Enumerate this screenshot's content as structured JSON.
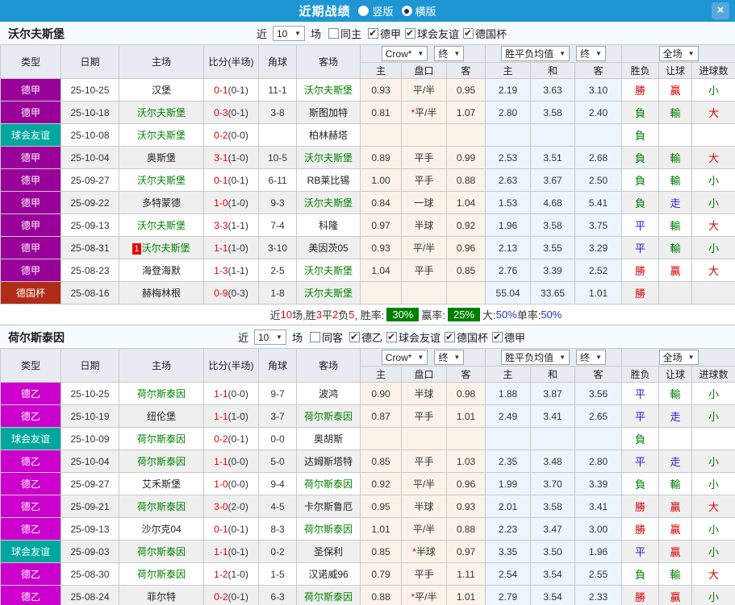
{
  "titlebar": {
    "title": "近期战绩",
    "vertical_label": "竖版",
    "horizontal_label": "横版",
    "close_glyph": "×"
  },
  "controls": {
    "near": "近",
    "count": "10",
    "games": "场",
    "crow": "Crow*",
    "final": "终",
    "avg": "胜平负均值",
    "fulltime": "全场"
  },
  "headers": {
    "type": "类型",
    "date": "日期",
    "home": "主场",
    "score": "比分(半场)",
    "corner": "角球",
    "away": "客场",
    "odds_home": "主",
    "handicap": "盘口",
    "odds_away": "客",
    "avg_home": "主",
    "avg_draw": "和",
    "avg_away": "客",
    "result": "胜负",
    "let_ball": "让球",
    "goals": "进球数"
  },
  "type_colors": {
    "德甲": "#990099",
    "德乙": "#CC00CC",
    "球会友谊": "#00A79E",
    "德国杯": "#B02C18"
  },
  "result_colors": {
    "勝": "#D50000",
    "贏": "#D50000",
    "大": "#D50000",
    "負": "#008000",
    "輸": "#008000",
    "小": "#008000",
    "平": "#2222D0",
    "走": "#2222D0"
  },
  "sections": [
    {
      "team": "沃尔夫斯堡",
      "same_label": "同主",
      "same_checked": false,
      "leagues": [
        {
          "label": "德甲",
          "checked": true
        },
        {
          "label": "球会友谊",
          "checked": true
        },
        {
          "label": "德国杯",
          "checked": true
        }
      ],
      "rows": [
        {
          "type": "德甲",
          "date": "25-10-25",
          "home": "汉堡",
          "home_focus": false,
          "rank": "",
          "score": "0-1",
          "half": "(0-1)",
          "corner": "11-1",
          "away": "沃尔夫斯堡",
          "away_focus": true,
          "odds": [
            "0.93",
            "平/半",
            "0.95"
          ],
          "avg": [
            "2.19",
            "3.63",
            "3.10"
          ],
          "outcome": [
            "勝",
            "贏",
            "小"
          ]
        },
        {
          "type": "德甲",
          "date": "25-10-18",
          "home": "沃尔夫斯堡",
          "home_focus": true,
          "rank": "",
          "score": "0-3",
          "half": "(0-1)",
          "corner": "3-8",
          "away": "斯图加特",
          "away_focus": false,
          "odds": [
            "0.81",
            "*平/半",
            "1.07"
          ],
          "avg": [
            "2.80",
            "3.58",
            "2.40"
          ],
          "outcome": [
            "負",
            "輸",
            "大"
          ]
        },
        {
          "type": "球会友谊",
          "date": "25-10-08",
          "home": "沃尔夫斯堡",
          "home_focus": true,
          "rank": "",
          "score": "0-2",
          "half": "(0-0)",
          "corner": "",
          "away": "柏林赫塔",
          "away_focus": false,
          "odds": [
            "",
            "",
            ""
          ],
          "avg": [
            "",
            "",
            ""
          ],
          "outcome": [
            "負",
            "",
            ""
          ]
        },
        {
          "type": "德甲",
          "date": "25-10-04",
          "home": "奥斯堡",
          "home_focus": false,
          "rank": "",
          "score": "3-1",
          "half": "(1-0)",
          "corner": "10-5",
          "away": "沃尔夫斯堡",
          "away_focus": true,
          "odds": [
            "0.89",
            "平手",
            "0.99"
          ],
          "avg": [
            "2.53",
            "3.51",
            "2.68"
          ],
          "outcome": [
            "負",
            "輸",
            "大"
          ]
        },
        {
          "type": "德甲",
          "date": "25-09-27",
          "home": "沃尔夫斯堡",
          "home_focus": true,
          "rank": "",
          "score": "0-1",
          "half": "(0-1)",
          "corner": "6-11",
          "away": "RB莱比锡",
          "away_focus": false,
          "odds": [
            "1.00",
            "平手",
            "0.88"
          ],
          "avg": [
            "2.63",
            "3.67",
            "2.50"
          ],
          "outcome": [
            "負",
            "輸",
            "小"
          ]
        },
        {
          "type": "德甲",
          "date": "25-09-22",
          "home": "多特蒙德",
          "home_focus": false,
          "rank": "",
          "score": "1-0",
          "half": "(1-0)",
          "corner": "9-3",
          "away": "沃尔夫斯堡",
          "away_focus": true,
          "odds": [
            "0.84",
            "一球",
            "1.04"
          ],
          "avg": [
            "1.53",
            "4.68",
            "5.41"
          ],
          "outcome": [
            "負",
            "走",
            "小"
          ]
        },
        {
          "type": "德甲",
          "date": "25-09-13",
          "home": "沃尔夫斯堡",
          "home_focus": true,
          "rank": "",
          "score": "3-3",
          "half": "(1-1)",
          "corner": "7-4",
          "away": "科隆",
          "away_focus": false,
          "odds": [
            "0.97",
            "半球",
            "0.92"
          ],
          "avg": [
            "1.96",
            "3.58",
            "3.75"
          ],
          "outcome": [
            "平",
            "輸",
            "大"
          ]
        },
        {
          "type": "德甲",
          "date": "25-08-31",
          "home": "沃尔夫斯堡",
          "home_focus": true,
          "rank": "1",
          "score": "1-1",
          "half": "(1-0)",
          "corner": "3-10",
          "away": "美因茨05",
          "away_focus": false,
          "odds": [
            "0.93",
            "平/半",
            "0.96"
          ],
          "avg": [
            "2.13",
            "3.55",
            "3.29"
          ],
          "outcome": [
            "平",
            "輸",
            "小"
          ]
        },
        {
          "type": "德甲",
          "date": "25-08-23",
          "home": "海登海默",
          "home_focus": false,
          "rank": "",
          "score": "1-3",
          "half": "(1-1)",
          "corner": "2-5",
          "away": "沃尔夫斯堡",
          "away_focus": true,
          "odds": [
            "1.04",
            "平手",
            "0.85"
          ],
          "avg": [
            "2.76",
            "3.39",
            "2.52"
          ],
          "outcome": [
            "勝",
            "贏",
            "大"
          ]
        },
        {
          "type": "德国杯",
          "date": "25-08-16",
          "home": "赫梅林根",
          "home_focus": false,
          "rank": "",
          "score": "0-9",
          "half": "(0-3)",
          "corner": "1-8",
          "away": "沃尔夫斯堡",
          "away_focus": true,
          "odds": [
            "",
            "",
            ""
          ],
          "avg": [
            "55.04",
            "33.65",
            "1.01"
          ],
          "outcome": [
            "勝",
            "",
            ""
          ]
        }
      ],
      "summary": [
        {
          "text": "近",
          "style": "plain"
        },
        {
          "text": "10",
          "style": "red"
        },
        {
          "text": "场,胜",
          "style": "plain"
        },
        {
          "text": "3",
          "style": "red"
        },
        {
          "text": "平",
          "style": "plain"
        },
        {
          "text": "2",
          "style": "red"
        },
        {
          "text": "负",
          "style": "plain"
        },
        {
          "text": "5",
          "style": "red"
        },
        {
          "text": ", 胜率: ",
          "style": "plain"
        },
        {
          "text": "30%",
          "style": "badge"
        },
        {
          "text": " 赢率: ",
          "style": "plain"
        },
        {
          "text": "25%",
          "style": "badge"
        },
        {
          "text": " 大:",
          "style": "plain"
        },
        {
          "text": "50%",
          "style": "blue"
        },
        {
          "text": " 单率:",
          "style": "plain"
        },
        {
          "text": "50%",
          "style": "blue"
        }
      ]
    },
    {
      "team": "荷尔斯泰因",
      "same_label": "同客",
      "same_checked": false,
      "leagues": [
        {
          "label": "德乙",
          "checked": true
        },
        {
          "label": "球会友谊",
          "checked": true
        },
        {
          "label": "德国杯",
          "checked": true
        },
        {
          "label": "德甲",
          "checked": true
        }
      ],
      "rows": [
        {
          "type": "德乙",
          "date": "25-10-25",
          "home": "荷尔斯泰因",
          "home_focus": true,
          "rank": "",
          "score": "1-1",
          "half": "(0-0)",
          "corner": "9-7",
          "away": "波鸿",
          "away_focus": false,
          "odds": [
            "0.90",
            "半球",
            "0.98"
          ],
          "avg": [
            "1.88",
            "3.87",
            "3.56"
          ],
          "outcome": [
            "平",
            "輸",
            "小"
          ]
        },
        {
          "type": "德乙",
          "date": "25-10-19",
          "home": "纽伦堡",
          "home_focus": false,
          "rank": "",
          "score": "1-1",
          "half": "(1-0)",
          "corner": "3-7",
          "away": "荷尔斯泰因",
          "away_focus": true,
          "odds": [
            "0.87",
            "平手",
            "1.01"
          ],
          "avg": [
            "2.49",
            "3.41",
            "2.65"
          ],
          "outcome": [
            "平",
            "走",
            "小"
          ]
        },
        {
          "type": "球会友谊",
          "date": "25-10-09",
          "home": "荷尔斯泰因",
          "home_focus": true,
          "rank": "",
          "score": "0-2",
          "half": "(0-1)",
          "corner": "0-0",
          "away": "奥胡斯",
          "away_focus": false,
          "odds": [
            "",
            "",
            ""
          ],
          "avg": [
            "",
            "",
            ""
          ],
          "outcome": [
            "負",
            "",
            ""
          ]
        },
        {
          "type": "德乙",
          "date": "25-10-04",
          "home": "荷尔斯泰因",
          "home_focus": true,
          "rank": "",
          "score": "1-1",
          "half": "(0-0)",
          "corner": "5-0",
          "away": "达姆斯塔特",
          "away_focus": false,
          "odds": [
            "0.85",
            "平手",
            "1.03"
          ],
          "avg": [
            "2.35",
            "3.48",
            "2.80"
          ],
          "outcome": [
            "平",
            "走",
            "小"
          ]
        },
        {
          "type": "德乙",
          "date": "25-09-27",
          "home": "艾禾斯堡",
          "home_focus": false,
          "rank": "",
          "score": "1-0",
          "half": "(0-0)",
          "corner": "9-4",
          "away": "荷尔斯泰因",
          "away_focus": true,
          "odds": [
            "0.92",
            "平/半",
            "0.96"
          ],
          "avg": [
            "1.99",
            "3.70",
            "3.39"
          ],
          "outcome": [
            "負",
            "輸",
            "小"
          ]
        },
        {
          "type": "德乙",
          "date": "25-09-21",
          "home": "荷尔斯泰因",
          "home_focus": true,
          "rank": "",
          "score": "3-0",
          "half": "(2-0)",
          "corner": "4-5",
          "away": "卡尔斯鲁厄",
          "away_focus": false,
          "odds": [
            "0.95",
            "半球",
            "0.93"
          ],
          "avg": [
            "2.01",
            "3.58",
            "3.41"
          ],
          "outcome": [
            "勝",
            "贏",
            "大"
          ]
        },
        {
          "type": "德乙",
          "date": "25-09-13",
          "home": "沙尔克04",
          "home_focus": false,
          "rank": "",
          "score": "0-1",
          "half": "(0-1)",
          "corner": "8-3",
          "away": "荷尔斯泰因",
          "away_focus": true,
          "odds": [
            "1.01",
            "平/半",
            "0.88"
          ],
          "avg": [
            "2.23",
            "3.47",
            "3.00"
          ],
          "outcome": [
            "勝",
            "贏",
            "小"
          ]
        },
        {
          "type": "球会友谊",
          "date": "25-09-03",
          "home": "荷尔斯泰因",
          "home_focus": true,
          "rank": "",
          "score": "1-1",
          "half": "(0-1)",
          "corner": "0-2",
          "away": "圣保利",
          "away_focus": false,
          "odds": [
            "0.85",
            "*半球",
            "0.97"
          ],
          "avg": [
            "3.35",
            "3.50",
            "1.96"
          ],
          "outcome": [
            "平",
            "贏",
            "小"
          ]
        },
        {
          "type": "德乙",
          "date": "25-08-30",
          "home": "荷尔斯泰因",
          "home_focus": true,
          "rank": "",
          "score": "1-2",
          "half": "(1-0)",
          "corner": "1-5",
          "away": "汉诺威96",
          "away_focus": false,
          "odds": [
            "0.79",
            "平手",
            "1.11"
          ],
          "avg": [
            "2.54",
            "3.54",
            "2.55"
          ],
          "outcome": [
            "負",
            "輸",
            "大"
          ]
        },
        {
          "type": "德乙",
          "date": "25-08-24",
          "home": "菲尔特",
          "home_focus": false,
          "rank": "",
          "score": "0-2",
          "half": "(0-1)",
          "corner": "6-3",
          "away": "荷尔斯泰因",
          "away_focus": true,
          "odds": [
            "0.88",
            "*平/半",
            "1.01"
          ],
          "avg": [
            "2.79",
            "3.54",
            "2.33"
          ],
          "outcome": [
            "勝",
            "贏",
            "小"
          ]
        }
      ],
      "summary": null
    }
  ]
}
